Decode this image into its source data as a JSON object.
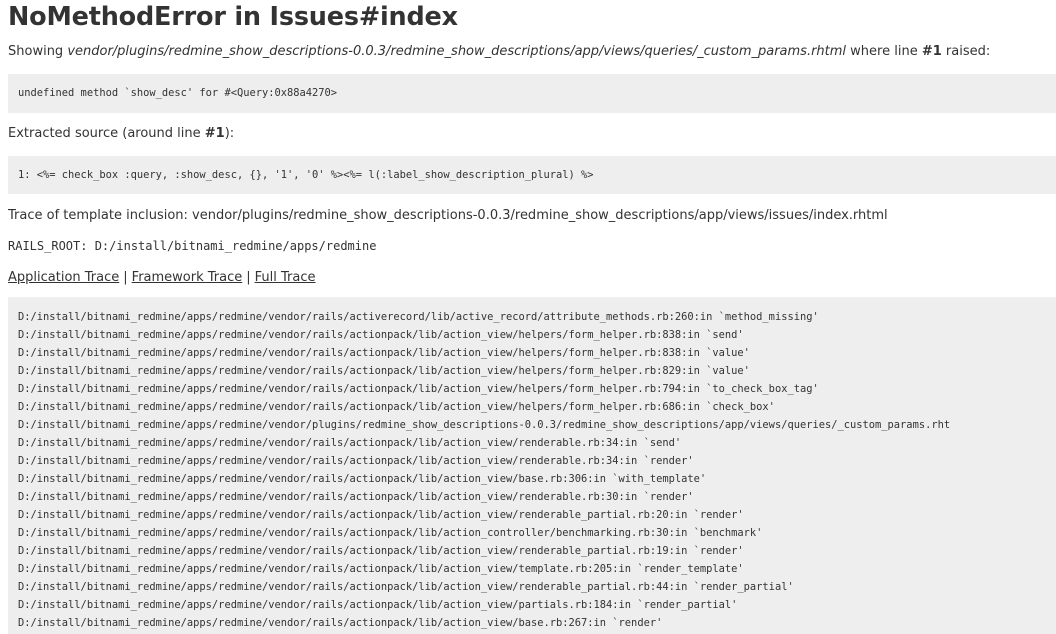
{
  "error": {
    "title": "NoMethodError in Issues#index",
    "showing_prefix": "Showing ",
    "template_path": "vendor/plugins/redmine_show_descriptions-0.0.3/redmine_show_descriptions/app/views/queries/_custom_params.rhtml",
    "showing_middle": " where line ",
    "line_number": "#1",
    "showing_suffix": " raised:",
    "message": "undefined method `show_desc' for #<Query:0x88a4270>"
  },
  "extracted": {
    "label_prefix": "Extracted source (around line ",
    "line_number": "#1",
    "label_suffix": "):",
    "source": "1: <%= check_box :query, :show_desc, {}, '1', '0' %><%= l(:label_show_description_plural) %>"
  },
  "trace_inclusion": "Trace of template inclusion: vendor/plugins/redmine_show_descriptions-0.0.3/redmine_show_descriptions/app/views/issues/index.rhtml",
  "rails_root": "RAILS_ROOT: D:/install/bitnami_redmine/apps/redmine",
  "trace_links": {
    "application": "Application Trace",
    "framework": "Framework Trace",
    "full": "Full Trace",
    "separator": "|"
  },
  "trace_lines": [
    "D:/install/bitnami_redmine/apps/redmine/vendor/rails/activerecord/lib/active_record/attribute_methods.rb:260:in `method_missing'",
    "D:/install/bitnami_redmine/apps/redmine/vendor/rails/actionpack/lib/action_view/helpers/form_helper.rb:838:in `send'",
    "D:/install/bitnami_redmine/apps/redmine/vendor/rails/actionpack/lib/action_view/helpers/form_helper.rb:838:in `value'",
    "D:/install/bitnami_redmine/apps/redmine/vendor/rails/actionpack/lib/action_view/helpers/form_helper.rb:829:in `value'",
    "D:/install/bitnami_redmine/apps/redmine/vendor/rails/actionpack/lib/action_view/helpers/form_helper.rb:794:in `to_check_box_tag'",
    "D:/install/bitnami_redmine/apps/redmine/vendor/rails/actionpack/lib/action_view/helpers/form_helper.rb:686:in `check_box'",
    "D:/install/bitnami_redmine/apps/redmine/vendor/plugins/redmine_show_descriptions-0.0.3/redmine_show_descriptions/app/views/queries/_custom_params.rht",
    "D:/install/bitnami_redmine/apps/redmine/vendor/rails/actionpack/lib/action_view/renderable.rb:34:in `send'",
    "D:/install/bitnami_redmine/apps/redmine/vendor/rails/actionpack/lib/action_view/renderable.rb:34:in `render'",
    "D:/install/bitnami_redmine/apps/redmine/vendor/rails/actionpack/lib/action_view/base.rb:306:in `with_template'",
    "D:/install/bitnami_redmine/apps/redmine/vendor/rails/actionpack/lib/action_view/renderable.rb:30:in `render'",
    "D:/install/bitnami_redmine/apps/redmine/vendor/rails/actionpack/lib/action_view/renderable_partial.rb:20:in `render'",
    "D:/install/bitnami_redmine/apps/redmine/vendor/rails/actionpack/lib/action_controller/benchmarking.rb:30:in `benchmark'",
    "D:/install/bitnami_redmine/apps/redmine/vendor/rails/actionpack/lib/action_view/renderable_partial.rb:19:in `render'",
    "D:/install/bitnami_redmine/apps/redmine/vendor/rails/actionpack/lib/action_view/template.rb:205:in `render_template'",
    "D:/install/bitnami_redmine/apps/redmine/vendor/rails/actionpack/lib/action_view/renderable_partial.rb:44:in `render_partial'",
    "D:/install/bitnami_redmine/apps/redmine/vendor/rails/actionpack/lib/action_view/partials.rb:184:in `render_partial'",
    "D:/install/bitnami_redmine/apps/redmine/vendor/rails/actionpack/lib/action_view/base.rb:267:in `render'"
  ]
}
